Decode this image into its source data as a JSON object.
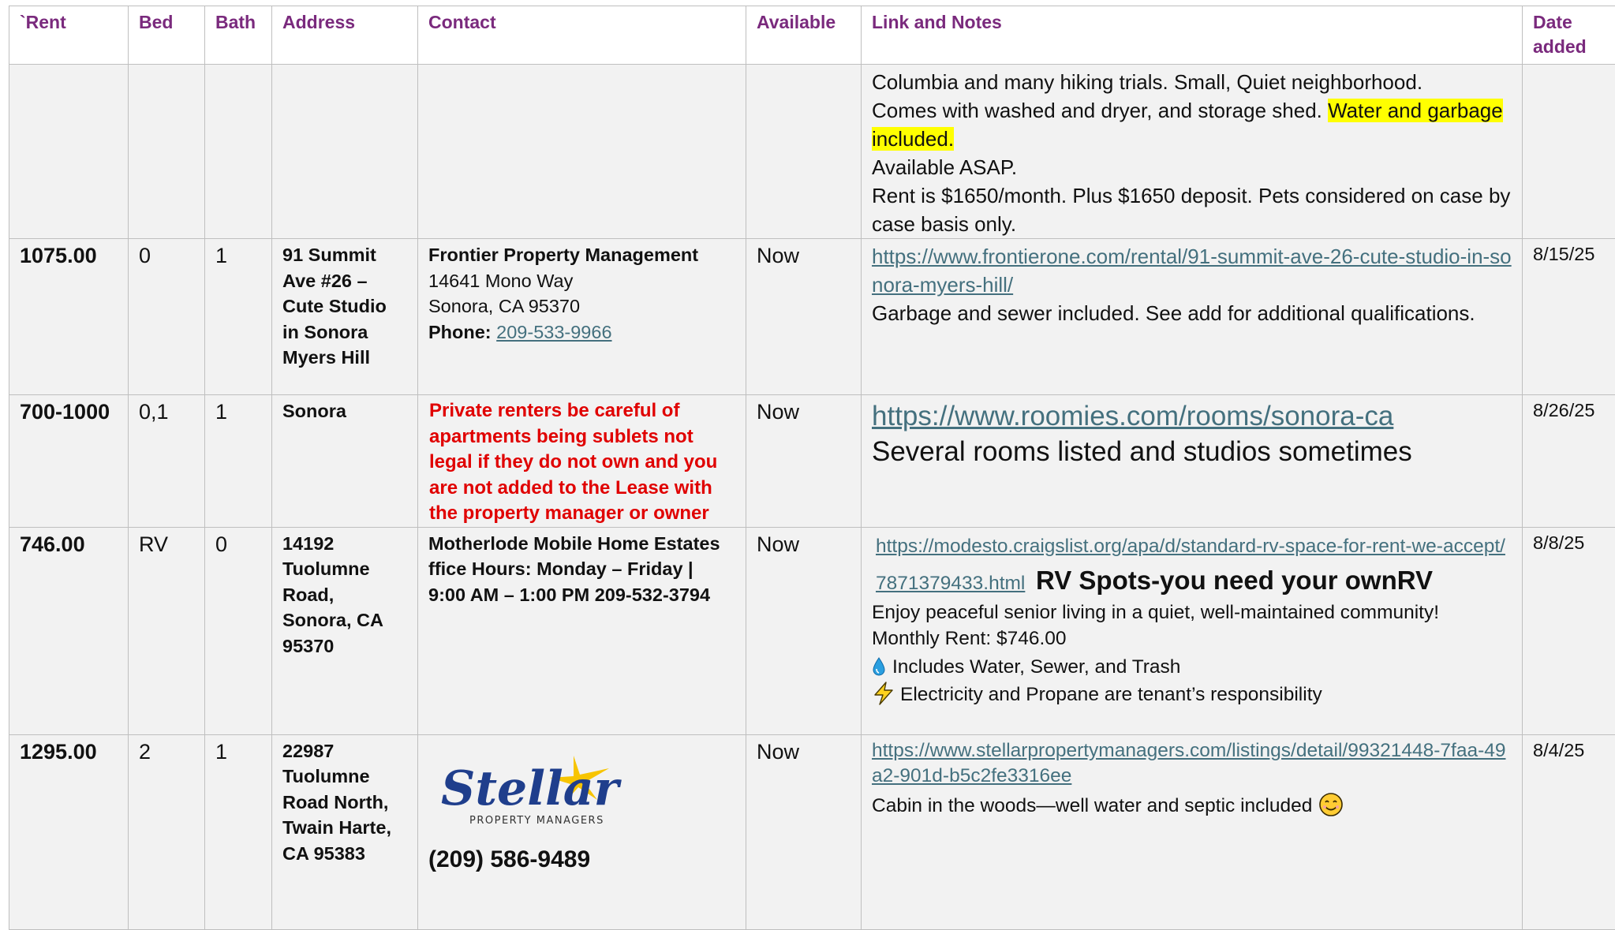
{
  "headers": [
    "`Rent",
    "Bed",
    "Bath",
    "Address",
    "Contact",
    "Available",
    "Link and Notes",
    "Date added"
  ],
  "row0": {
    "notes_line1": "Columbia and many hiking trials. Small, Quiet neighborhood.",
    "notes_line2_pre": "Comes with washed and dryer, and storage shed. ",
    "notes_highlight": "Water and garbage included.",
    "notes_line3": "Available ASAP.",
    "notes_line4": "Rent is $1650/month. Plus $1650 deposit. Pets considered on case by case basis only."
  },
  "row1": {
    "rent": "1075.00",
    "bed": "0",
    "bath": "1",
    "address": "91 Summit Ave #26 – Cute Studio in Sonora Myers Hill",
    "contact_name": "Frontier Property Management",
    "contact_street": "14641 Mono Way",
    "contact_city": "Sonora, CA 95370",
    "contact_phone_label": "Phone:",
    "contact_phone": "209-533-9966",
    "available": "Now",
    "link": "https://www.frontierone.com/rental/91-summit-ave-26-cute-studio-in-sonora-myers-hill/",
    "notes": "Garbage and sewer included. See add for additional qualifications.",
    "date": "8/15/25"
  },
  "row2": {
    "rent": "700-1000",
    "bed": "0,1",
    "bath": "1",
    "address": "Sonora",
    "warning": "Private renters be careful of apartments being sublets not legal if they do not own and you are not added to the Lease with the property manager or owner",
    "available": "Now",
    "link": "https://www.roomies.com/rooms/sonora-ca",
    "notes": "Several rooms listed and studios sometimes",
    "date": "8/26/25"
  },
  "row3": {
    "rent": "746.00",
    "bed": "RV",
    "bath": "0",
    "address": "14192 Tuolumne Road, Sonora, CA 95370",
    "contact": "Motherlode Mobile Home Estates ffice Hours: Monday – Friday | 9:00 AM – 1:00 PM 209-532-3794",
    "available": "Now",
    "link": "https://modesto.craigslist.org/apa/d/standard-rv-space-for-rent-we-accept/7871379433.html",
    "title": "RV Spots-you need your ownRV",
    "line1": "Enjoy peaceful senior living in a quiet, well-maintained community!",
    "line2": "Monthly Rent: $746.00",
    "line3": "Includes Water, Sewer, and Trash",
    "line4": "Electricity and Propane are tenant’s responsibility",
    "date": "8/8/25"
  },
  "row4": {
    "rent": "1295.00",
    "bed": "2",
    "bath": "1",
    "address": "22987 Tuolumne Road North, Twain Harte, CA 95383",
    "logo_main": "Stellar",
    "logo_sub": "PROPERTY MANAGERS",
    "phone": "(209) 586-9489",
    "available": "Now",
    "link": "https://www.stellarpropertymanagers.com/listings/detail/99321448-7faa-49a2-901d-b5c2fe3316ee",
    "notes": "Cabin in the woods—well water and septic included",
    "date": "8/4/25"
  },
  "colors": {
    "header_text": "#7a2a7d",
    "link": "#44707e",
    "warning": "#e00000",
    "highlight": "#ffff00",
    "row_bg": "#f2f2f2",
    "logo_blue": "#1f3e8c",
    "logo_star": "#f7c400"
  },
  "icons": [
    "water-drop-icon",
    "lightning-icon",
    "smiley-icon",
    "stellar-logo-star"
  ]
}
